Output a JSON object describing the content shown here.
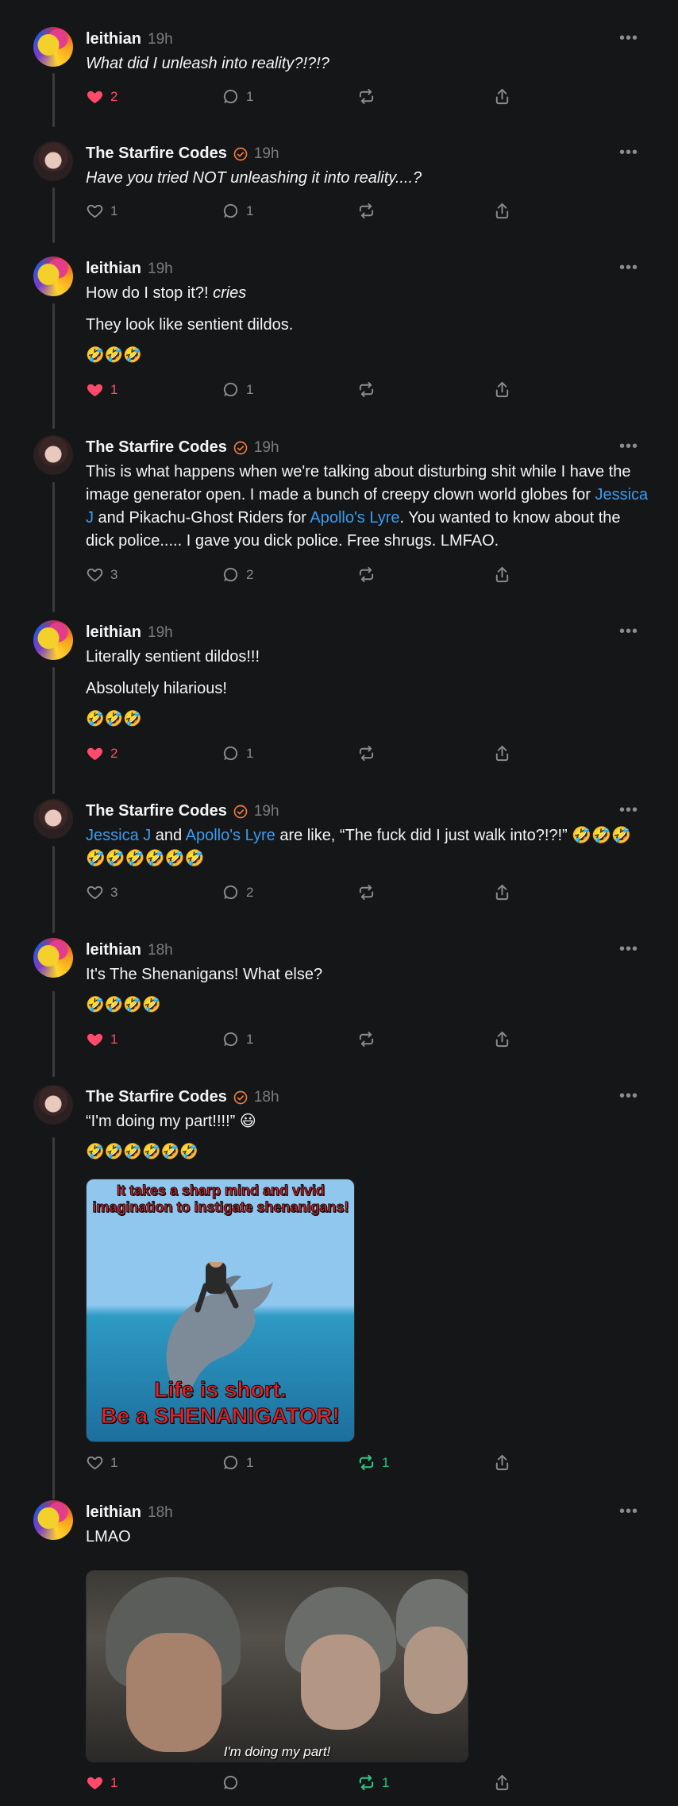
{
  "posts": [
    {
      "user": "leithian",
      "time": "19h",
      "lines": [
        "What did I unleash into reality?!?!?"
      ],
      "actions": {
        "likes": "2",
        "replies": "1"
      },
      "liked": true
    },
    {
      "user": "The Starfire Codes",
      "time": "19h",
      "lines": [
        "Have you tried NOT unleashing it into reality....?"
      ],
      "actions": {
        "likes": "1",
        "replies": "1"
      }
    },
    {
      "user": "leithian",
      "time": "19h",
      "line1_text": "How do I stop it?! ",
      "line1_italic": "cries",
      "line2": "They look like sentient dildos.",
      "emoji": "🤣🤣🤣",
      "actions": {
        "likes": "1",
        "replies": "1"
      },
      "liked": true
    },
    {
      "user": "The Starfire Codes",
      "time": "19h",
      "p1": "This is what happens when we're talking about disturbing shit while I have the image generator open. I made a bunch of creepy clown world globes for ",
      "link1": "Jessica J",
      "p2": " and Pikachu-Ghost Riders for ",
      "link2": "Apollo's Lyre",
      "p3": ". You wanted to know about the dick police..... I gave you dick police. Free shrugs. LMFAO.",
      "actions": {
        "likes": "3",
        "replies": "2"
      }
    },
    {
      "user": "leithian",
      "time": "19h",
      "line1": "Literally sentient dildos!!!",
      "line2": "Absolutely hilarious!",
      "emoji": "🤣🤣🤣",
      "actions": {
        "likes": "2",
        "replies": "1"
      },
      "liked": true
    },
    {
      "user": "The Starfire Codes",
      "time": "19h",
      "link1": "Jessica J",
      "t1": " and ",
      "link2": "Apollo's Lyre",
      "t2": " are like, “The fuck did I just walk into?!?!” 🤣🤣🤣 🤣🤣🤣🤣🤣🤣",
      "actions": {
        "likes": "3",
        "replies": "2"
      }
    },
    {
      "user": "leithian",
      "time": "18h",
      "line1": "It's The Shenanigans! What else?",
      "emoji": "🤣🤣🤣🤣",
      "actions": {
        "likes": "1",
        "replies": "1"
      },
      "liked": true
    },
    {
      "user": "The Starfire Codes",
      "time": "18h",
      "line1": "“I'm doing my part!!!!” 😃",
      "emoji": "🤣🤣🤣🤣🤣🤣",
      "meme_top": "It takes a sharp mind and vivid imagination to instigate shenanigans!",
      "meme_bottom1": "Life is short.",
      "meme_bottom2": "Be a SHENANIGATOR!",
      "actions": {
        "likes": "1",
        "replies": "1",
        "reposts": "1"
      }
    },
    {
      "user": "leithian",
      "time": "18h",
      "line1": "LMAO",
      "gif_caption": "I'm doing my part!",
      "actions": {
        "likes": "1",
        "reposts": "1"
      },
      "liked": true
    }
  ],
  "icons": {
    "more": "more-icon",
    "heart": "heart-icon",
    "reply": "reply-icon",
    "repost": "repost-icon",
    "share": "share-icon",
    "verified": "verified-icon"
  },
  "colors": {
    "background": "#151617",
    "liked": "#ff4a6b",
    "reposted": "#2ec27e",
    "link": "#3b9cf2",
    "verified": "#f07a3c"
  }
}
